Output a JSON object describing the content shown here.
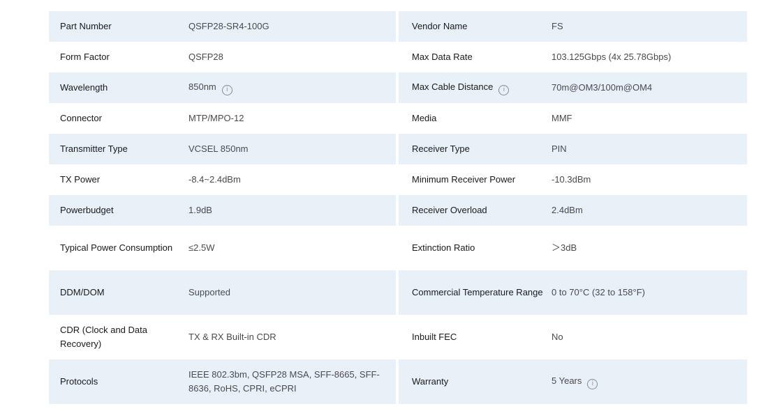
{
  "specs": [
    {
      "left_label": "Part Number",
      "left_value": "QSFP28-SR4-100G",
      "right_label": "Vendor Name",
      "right_value": "FS"
    },
    {
      "left_label": "Form Factor",
      "left_value": "QSFP28",
      "right_label": "Max Data Rate",
      "right_value": "103.125Gbps (4x 25.78Gbps)"
    },
    {
      "left_label": "Wavelength",
      "left_value": "850nm",
      "right_label": "Max Cable Distance",
      "right_value": "70m@OM3/100m@OM4"
    },
    {
      "left_label": "Connector",
      "left_value": "MTP/MPO-12",
      "right_label": "Media",
      "right_value": "MMF"
    },
    {
      "left_label": "Transmitter Type",
      "left_value": "VCSEL 850nm",
      "right_label": "Receiver Type",
      "right_value": "PIN"
    },
    {
      "left_label": "TX Power",
      "left_value": "-8.4~2.4dBm",
      "right_label": "Minimum Receiver Power",
      "right_value": "-10.3dBm"
    },
    {
      "left_label": "Powerbudget",
      "left_value": "1.9dB",
      "right_label": "Receiver Overload",
      "right_value": "2.4dBm"
    },
    {
      "left_label": "Typical Power Consumption",
      "left_value": "≤2.5W",
      "right_label": "Extinction Ratio",
      "right_value": "＞3dB"
    },
    {
      "left_label": "DDM/DOM",
      "left_value": "Supported",
      "right_label": "Commercial Temperature Range",
      "right_value": "0 to 70°C (32 to 158°F)"
    },
    {
      "left_label": "CDR (Clock and Data Recovery)",
      "left_value": "TX & RX Built-in CDR",
      "right_label": "Inbuilt FEC",
      "right_value": "No"
    },
    {
      "left_label": "Protocols",
      "left_value": "IEEE 802.3bm, QSFP28 MSA, SFF-8665, SFF-8636, RoHS, CPRI, eCPRI",
      "right_label": "Warranty",
      "right_value": "5 Years"
    }
  ],
  "icons": {
    "info": "info-circle-icon",
    "info_glyph": "i"
  },
  "colors": {
    "shaded_row": "#e9f1f8",
    "label_text": "#19191a",
    "value_text": "#4a4a4d"
  }
}
